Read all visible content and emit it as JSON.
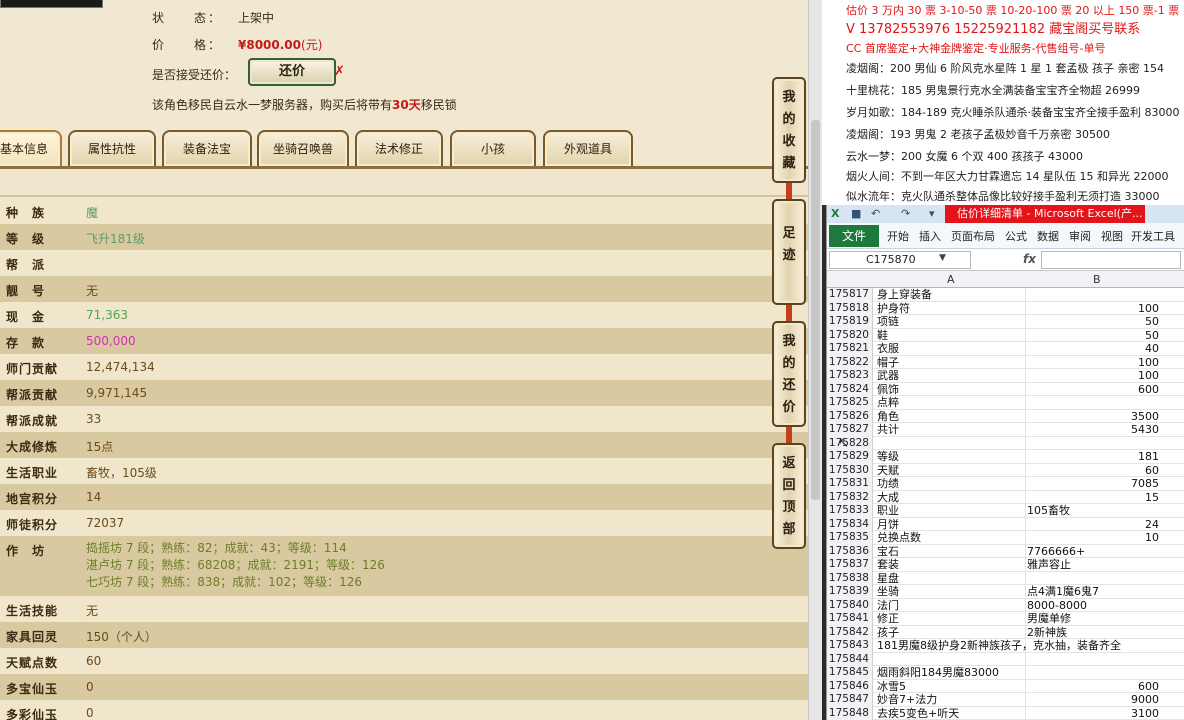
{
  "game": {
    "status_label": "状　　态：",
    "status_value": "上架中",
    "price_label": "价　　格：",
    "price_value": "¥8000.00",
    "price_unit": "(元)",
    "bargain_label": "是否接受还价：",
    "bargain_button": "还价",
    "bargain_x": "✗",
    "migrate_pre": "该角色移民自云水一梦服务器，购买后将带有",
    "migrate_days": "30天",
    "migrate_post": "移民锁",
    "tabs": [
      "基本信息",
      "属性抗性",
      "装备法宝",
      "坐骑召唤兽",
      "法术修正",
      "小孩",
      "外观道具"
    ],
    "attrs": [
      {
        "k": "种　族",
        "v": "魔"
      },
      {
        "k": "等　级",
        "v": "飞升181级"
      },
      {
        "k": "帮　派",
        "v": ""
      },
      {
        "k": "靓　号",
        "v": "无"
      },
      {
        "k": "现　金",
        "v": "71,363"
      },
      {
        "k": "存　款",
        "v": "500,000"
      },
      {
        "k": "师门贡献",
        "v": "12,474,134"
      },
      {
        "k": "帮派贡献",
        "v": "9,971,145"
      },
      {
        "k": "帮派成就",
        "v": "33"
      },
      {
        "k": "大成修炼",
        "v": "15点"
      },
      {
        "k": "生活职业",
        "v": "畜牧，105级"
      },
      {
        "k": "地宫积分",
        "v": "14"
      },
      {
        "k": "师徒积分",
        "v": "72037"
      },
      {
        "k": "作　坊",
        "v1": "捣摇坊 7 段；熟练：82；成就：43；等级：114",
        "v2": "湛卢坊 7 段；熟练：68208；成就：2191；等级：126",
        "v3": "七巧坊 7 段；熟练：838；成就：102；等级：126"
      },
      {
        "k": "生活技能",
        "v": "无"
      },
      {
        "k": "家具回灵",
        "v": "150（个人）"
      },
      {
        "k": "天赋点数",
        "v": "60"
      },
      {
        "k": "多宝仙玉",
        "v": "0"
      },
      {
        "k": "多彩仙玉",
        "v": "0"
      }
    ],
    "side": [
      "我的收藏",
      "足迹",
      "我的还价",
      "返回顶部"
    ]
  },
  "doc": {
    "top": "估价 3 万内 30 票  3-10-50 票  10-20-100 票  20 以上 150 票-1 票 1 元",
    "contact": "V 13782553976    15225921182  藏宝阁买号联系",
    "service": "CC 首席鉴定+大神金牌鉴定·专业服务-代售组号-单号",
    "lines": [
      "凌烟阁：200 男仙 6 阶风克水星阵 1 星 1 套孟极 孩子 亲密 154",
      "十里桃花：185 男鬼景行克水全满装备宝宝齐全物超 26999",
      "岁月如歌：184-189 克火睡杀队通杀·装备宝宝齐全接手盈利 83000",
      "凌烟阁：193 男鬼 2 老孩子孟极妙音千万亲密 30500",
      "云水一梦：200 女魔 6 个双 400 孩孩子 43000",
      "烟火人间：不到一年区大力甘霖遗忘 14 星队伍 15 和异光 22000",
      "似水流年：克火队通杀整体品像比较好接手盈利无须打造 33000"
    ]
  },
  "excel": {
    "title": "估价详细清单 - Microsoft Excel(产...",
    "file_tab": "文件",
    "ribbon": [
      "开始",
      "插入",
      "页面布局",
      "公式",
      "数据",
      "审阅",
      "视图",
      "开发工具"
    ],
    "namebox": "C175870",
    "fx": "fx",
    "col_a": "A",
    "col_b": "B",
    "rows": [
      {
        "n": "175817",
        "a": "身上穿装备",
        "b": ""
      },
      {
        "n": "175818",
        "a": "护身符",
        "b": "100"
      },
      {
        "n": "175819",
        "a": "项链",
        "b": "50"
      },
      {
        "n": "175820",
        "a": "鞋",
        "b": "50"
      },
      {
        "n": "175821",
        "a": "衣服",
        "b": "40"
      },
      {
        "n": "175822",
        "a": "帽子",
        "b": "100"
      },
      {
        "n": "175823",
        "a": "武器",
        "b": "100"
      },
      {
        "n": "175824",
        "a": "佩饰",
        "b": "600"
      },
      {
        "n": "175825",
        "a": "点粹",
        "b": ""
      },
      {
        "n": "175826",
        "a": "角色",
        "b": "3500"
      },
      {
        "n": "175827",
        "a": "共计",
        "b": "5430"
      },
      {
        "n": "175828",
        "a": "",
        "b": ""
      },
      {
        "n": "175829",
        "a": "等级",
        "b": "181"
      },
      {
        "n": "175830",
        "a": "天赋",
        "b": "60"
      },
      {
        "n": "175831",
        "a": "功绩",
        "b": "7085"
      },
      {
        "n": "175832",
        "a": "大成",
        "b": "15"
      },
      {
        "n": "175833",
        "a": "职业",
        "b": "105畜牧",
        "t": true
      },
      {
        "n": "175834",
        "a": "月饼",
        "b": "24"
      },
      {
        "n": "175835",
        "a": "兑换点数",
        "b": "10"
      },
      {
        "n": "175836",
        "a": "宝石",
        "b": "7766666+",
        "t": true
      },
      {
        "n": "175837",
        "a": "套装",
        "b": "雅声容止",
        "t": true
      },
      {
        "n": "175838",
        "a": "星盘",
        "b": ""
      },
      {
        "n": "175839",
        "a": "坐骑",
        "b": "点4满1魔6鬼7",
        "t": true
      },
      {
        "n": "175840",
        "a": "法门",
        "b": "8000-8000",
        "t": true
      },
      {
        "n": "175841",
        "a": "修正",
        "b": "男魔单修",
        "t": true
      },
      {
        "n": "175842",
        "a": "孩子",
        "b": "2新神族",
        "t": true
      },
      {
        "n": "175843",
        "a": "181男魔8级护身2新神族孩子，克水抽，装备齐全",
        "b": ""
      },
      {
        "n": "175844",
        "a": "",
        "b": ""
      },
      {
        "n": "175845",
        "a": "烟雨斜阳184男魔83000",
        "b": ""
      },
      {
        "n": "175846",
        "a": "冰雪5",
        "b": "600"
      },
      {
        "n": "175847",
        "a": "妙音7+法力",
        "b": "9000"
      },
      {
        "n": "175848",
        "a": "去疾5变色+听天",
        "b": "3100"
      }
    ]
  }
}
